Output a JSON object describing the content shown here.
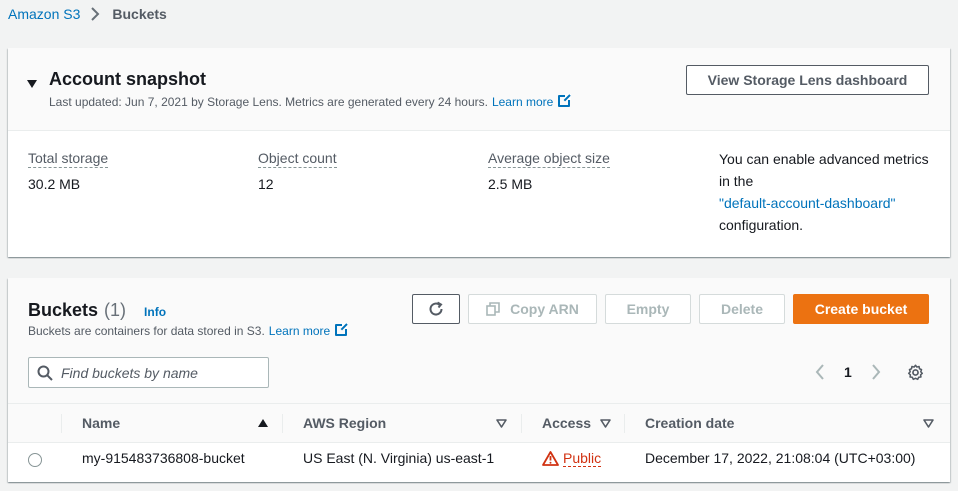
{
  "breadcrumb": {
    "root": "Amazon S3",
    "current": "Buckets"
  },
  "snapshot": {
    "title": "Account snapshot",
    "updated": "Last updated: Jun 7, 2021 by Storage Lens. Metrics are generated every 24 hours.",
    "learn_more": "Learn more",
    "lens_button": "View Storage Lens dashboard",
    "metrics": [
      {
        "label": "Total storage",
        "value": "30.2 MB"
      },
      {
        "label": "Object count",
        "value": "12"
      },
      {
        "label": "Average object size",
        "value": "2.5 MB"
      }
    ],
    "advanced_line1": "You can enable advanced metrics",
    "advanced_line2": "in the",
    "advanced_link": "\"default-account-dashboard\"",
    "advanced_line3": "configuration."
  },
  "buckets": {
    "title": "Buckets",
    "count": "(1)",
    "info": "Info",
    "description": "Buckets are containers for data stored in S3.",
    "learn_more": "Learn more",
    "buttons": {
      "copy_arn": "Copy ARN",
      "empty": "Empty",
      "delete": "Delete",
      "create": "Create bucket"
    },
    "search_placeholder": "Find buckets by name",
    "page": "1",
    "columns": {
      "name": "Name",
      "region": "AWS Region",
      "access": "Access",
      "created": "Creation date"
    },
    "rows": [
      {
        "name": "my-915483736808-bucket",
        "region": "US East (N. Virginia) us-east-1",
        "access": "Public",
        "created": "December 17, 2022, 21:08:04 (UTC+03:00)"
      }
    ]
  },
  "colors": {
    "primary": "#ec7211",
    "link": "#0073bb",
    "warning": "#d13212"
  }
}
